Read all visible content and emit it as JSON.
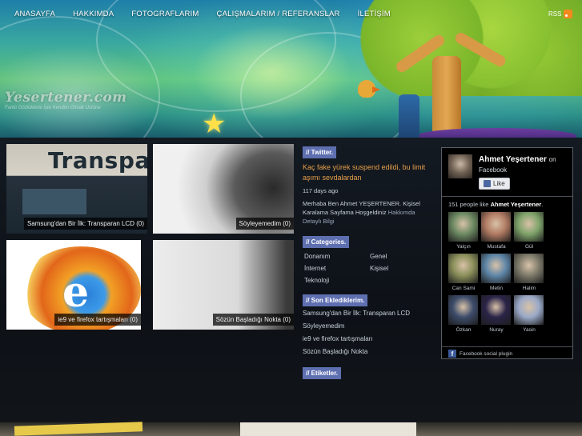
{
  "nav": {
    "items": [
      "ANASAYFA",
      "HAKKIMDA",
      "FOTOGRAFLARIM",
      "ÇALIŞMALARIM / REFERANSLAR",
      "İLETİŞİM"
    ],
    "rss_label": "RSS"
  },
  "logo": {
    "title": "Yesertener.com",
    "slogan": "Farklı Gözlüklerle İşte Kendim Olmak Ustüne"
  },
  "posts": [
    {
      "caption": "Samsung'dan Bir İlk: Transparan LCD (0)",
      "image_text": "Transpare"
    },
    {
      "caption": "Söyleyemedim (0)"
    },
    {
      "caption": "ie9 ve firefox tartışmaları (0)"
    },
    {
      "caption": "Sözün Başladığı Nokta (0)"
    }
  ],
  "twitter": {
    "title": "// Twitter.",
    "tweet": "Kaç fake yürek suspend edildi, bu limit aşımı sevdalardan",
    "time": "117 days ago",
    "about": "Merhaba Ben Ahmet YEŞERTENER. Kişisel Karalama Sayfama Hoşgeldiniz",
    "about_more": "Hakkımda Detaylı Bilgi"
  },
  "categories": {
    "title": "// Categories.",
    "items": [
      "Donanım",
      "Genel",
      "İnternet",
      "Kişisel",
      "Teknoloji"
    ]
  },
  "recent": {
    "title": "// Son Eklediklerim.",
    "items": [
      "Samsung'dan Bir İlk: Transparan LCD",
      "Söyleyemedim",
      "ie9 ve firefox tartışmaları",
      "Sözün Başladığı Nokta"
    ]
  },
  "tags": {
    "title": "// Etiketler."
  },
  "facebook": {
    "name": "Ahmet Yeşertener",
    "on": "on",
    "platform": "Facebook",
    "like_label": "Like",
    "count_text": "151 people like",
    "count_name": "Ahmet Yeşertener",
    "count_dot": ".",
    "fans": [
      {
        "name": "Yalçın",
        "color": "#6d8a63"
      },
      {
        "name": "Mustafa",
        "color": "#b07a62"
      },
      {
        "name": "Gül",
        "color": "#7fa36a"
      },
      {
        "name": "Can Sami",
        "color": "#8a8f5a"
      },
      {
        "name": "Metin",
        "color": "#5e86a8"
      },
      {
        "name": "Halim",
        "color": "#7d7a6a"
      },
      {
        "name": "Özkan",
        "color": "#3d4c6a"
      },
      {
        "name": "Nuray",
        "color": "#2b2448"
      },
      {
        "name": "Yasin",
        "color": "#9aa9c8"
      }
    ],
    "footer": "Facebook social plugin"
  }
}
